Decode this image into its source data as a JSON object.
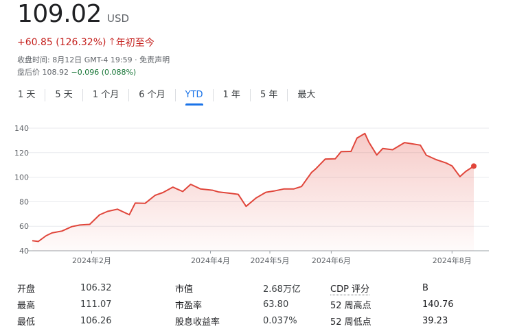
{
  "quote": {
    "price": "109.02",
    "currency": "USD",
    "change": "+60.85 (126.32%)",
    "direction_icon": "arrow-up-icon",
    "period": "年初至今",
    "close_time": "收盘时间: 8月12日 GMT-4 19:59 · 免责声明",
    "after_hours_label": "盘后价 108.92 ",
    "after_hours_change": "−0.096 (0.088%)",
    "change_color": "#c5221f",
    "after_hours_color": "#137333"
  },
  "tabs": [
    {
      "label": "1 天"
    },
    {
      "label": "5 天"
    },
    {
      "label": "1 个月"
    },
    {
      "label": "6 个月"
    },
    {
      "label": "YTD"
    },
    {
      "label": "1 年"
    },
    {
      "label": "5 年"
    },
    {
      "label": "最大"
    }
  ],
  "active_tab": "YTD",
  "chart_data": {
    "type": "area",
    "title": "",
    "xlabel": "",
    "ylabel": "",
    "ylim": [
      40,
      145
    ],
    "y_ticks": [
      40,
      60,
      80,
      100,
      120,
      140
    ],
    "x_tick_labels": [
      "2024年2月",
      "2024年4月",
      "2024年5月",
      "2024年6月",
      "2024年8月"
    ],
    "grid": true,
    "line_color": "#e0453a",
    "x": [
      "2024-01-02",
      "2024-01-05",
      "2024-01-09",
      "2024-01-12",
      "2024-01-17",
      "2024-01-22",
      "2024-01-26",
      "2024-01-31",
      "2024-02-05",
      "2024-02-09",
      "2024-02-14",
      "2024-02-20",
      "2024-02-23",
      "2024-02-28",
      "2024-03-04",
      "2024-03-08",
      "2024-03-13",
      "2024-03-18",
      "2024-03-22",
      "2024-03-27",
      "2024-04-02",
      "2024-04-05",
      "2024-04-10",
      "2024-04-15",
      "2024-04-19",
      "2024-04-24",
      "2024-04-29",
      "2024-05-03",
      "2024-05-08",
      "2024-05-13",
      "2024-05-17",
      "2024-05-22",
      "2024-05-24",
      "2024-05-29",
      "2024-06-03",
      "2024-06-06",
      "2024-06-11",
      "2024-06-14",
      "2024-06-18",
      "2024-06-20",
      "2024-06-24",
      "2024-06-27",
      "2024-07-02",
      "2024-07-08",
      "2024-07-11",
      "2024-07-16",
      "2024-07-19",
      "2024-07-24",
      "2024-07-29",
      "2024-08-01",
      "2024-08-05",
      "2024-08-08",
      "2024-08-12"
    ],
    "series": [
      {
        "values": [
          48.2,
          47.6,
          52.3,
          54.6,
          56.1,
          59.7,
          61.0,
          61.5,
          69.3,
          72.1,
          73.9,
          69.4,
          78.9,
          78.7,
          85.2,
          87.5,
          91.9,
          88.3,
          94.2,
          90.4,
          89.4,
          88.0,
          87.0,
          86.0,
          76.2,
          83.0,
          87.7,
          88.7,
          90.4,
          90.4,
          92.4,
          103.8,
          106.5,
          114.8,
          115.0,
          120.9,
          121.0,
          131.9,
          135.6,
          128.5,
          118.1,
          123.4,
          122.4,
          128.2,
          127.4,
          126.1,
          117.9,
          114.3,
          111.6,
          109.2,
          100.5,
          104.8,
          109.02
        ]
      }
    ]
  },
  "stats": [
    {
      "label": "开盘",
      "value": "106.32",
      "label2": "市值",
      "value2": "2.68万亿",
      "label3": "CDP 评分",
      "value3": "B"
    },
    {
      "label": "最高",
      "value": "111.07",
      "label2": "市盈率",
      "value2": "63.80",
      "label3": "52 周高点",
      "value3": "140.76"
    },
    {
      "label": "最低",
      "value": "106.26",
      "label2": "股息收益率",
      "value2": "0.037%",
      "label3": "52 周低点",
      "value3": "39.23"
    }
  ]
}
